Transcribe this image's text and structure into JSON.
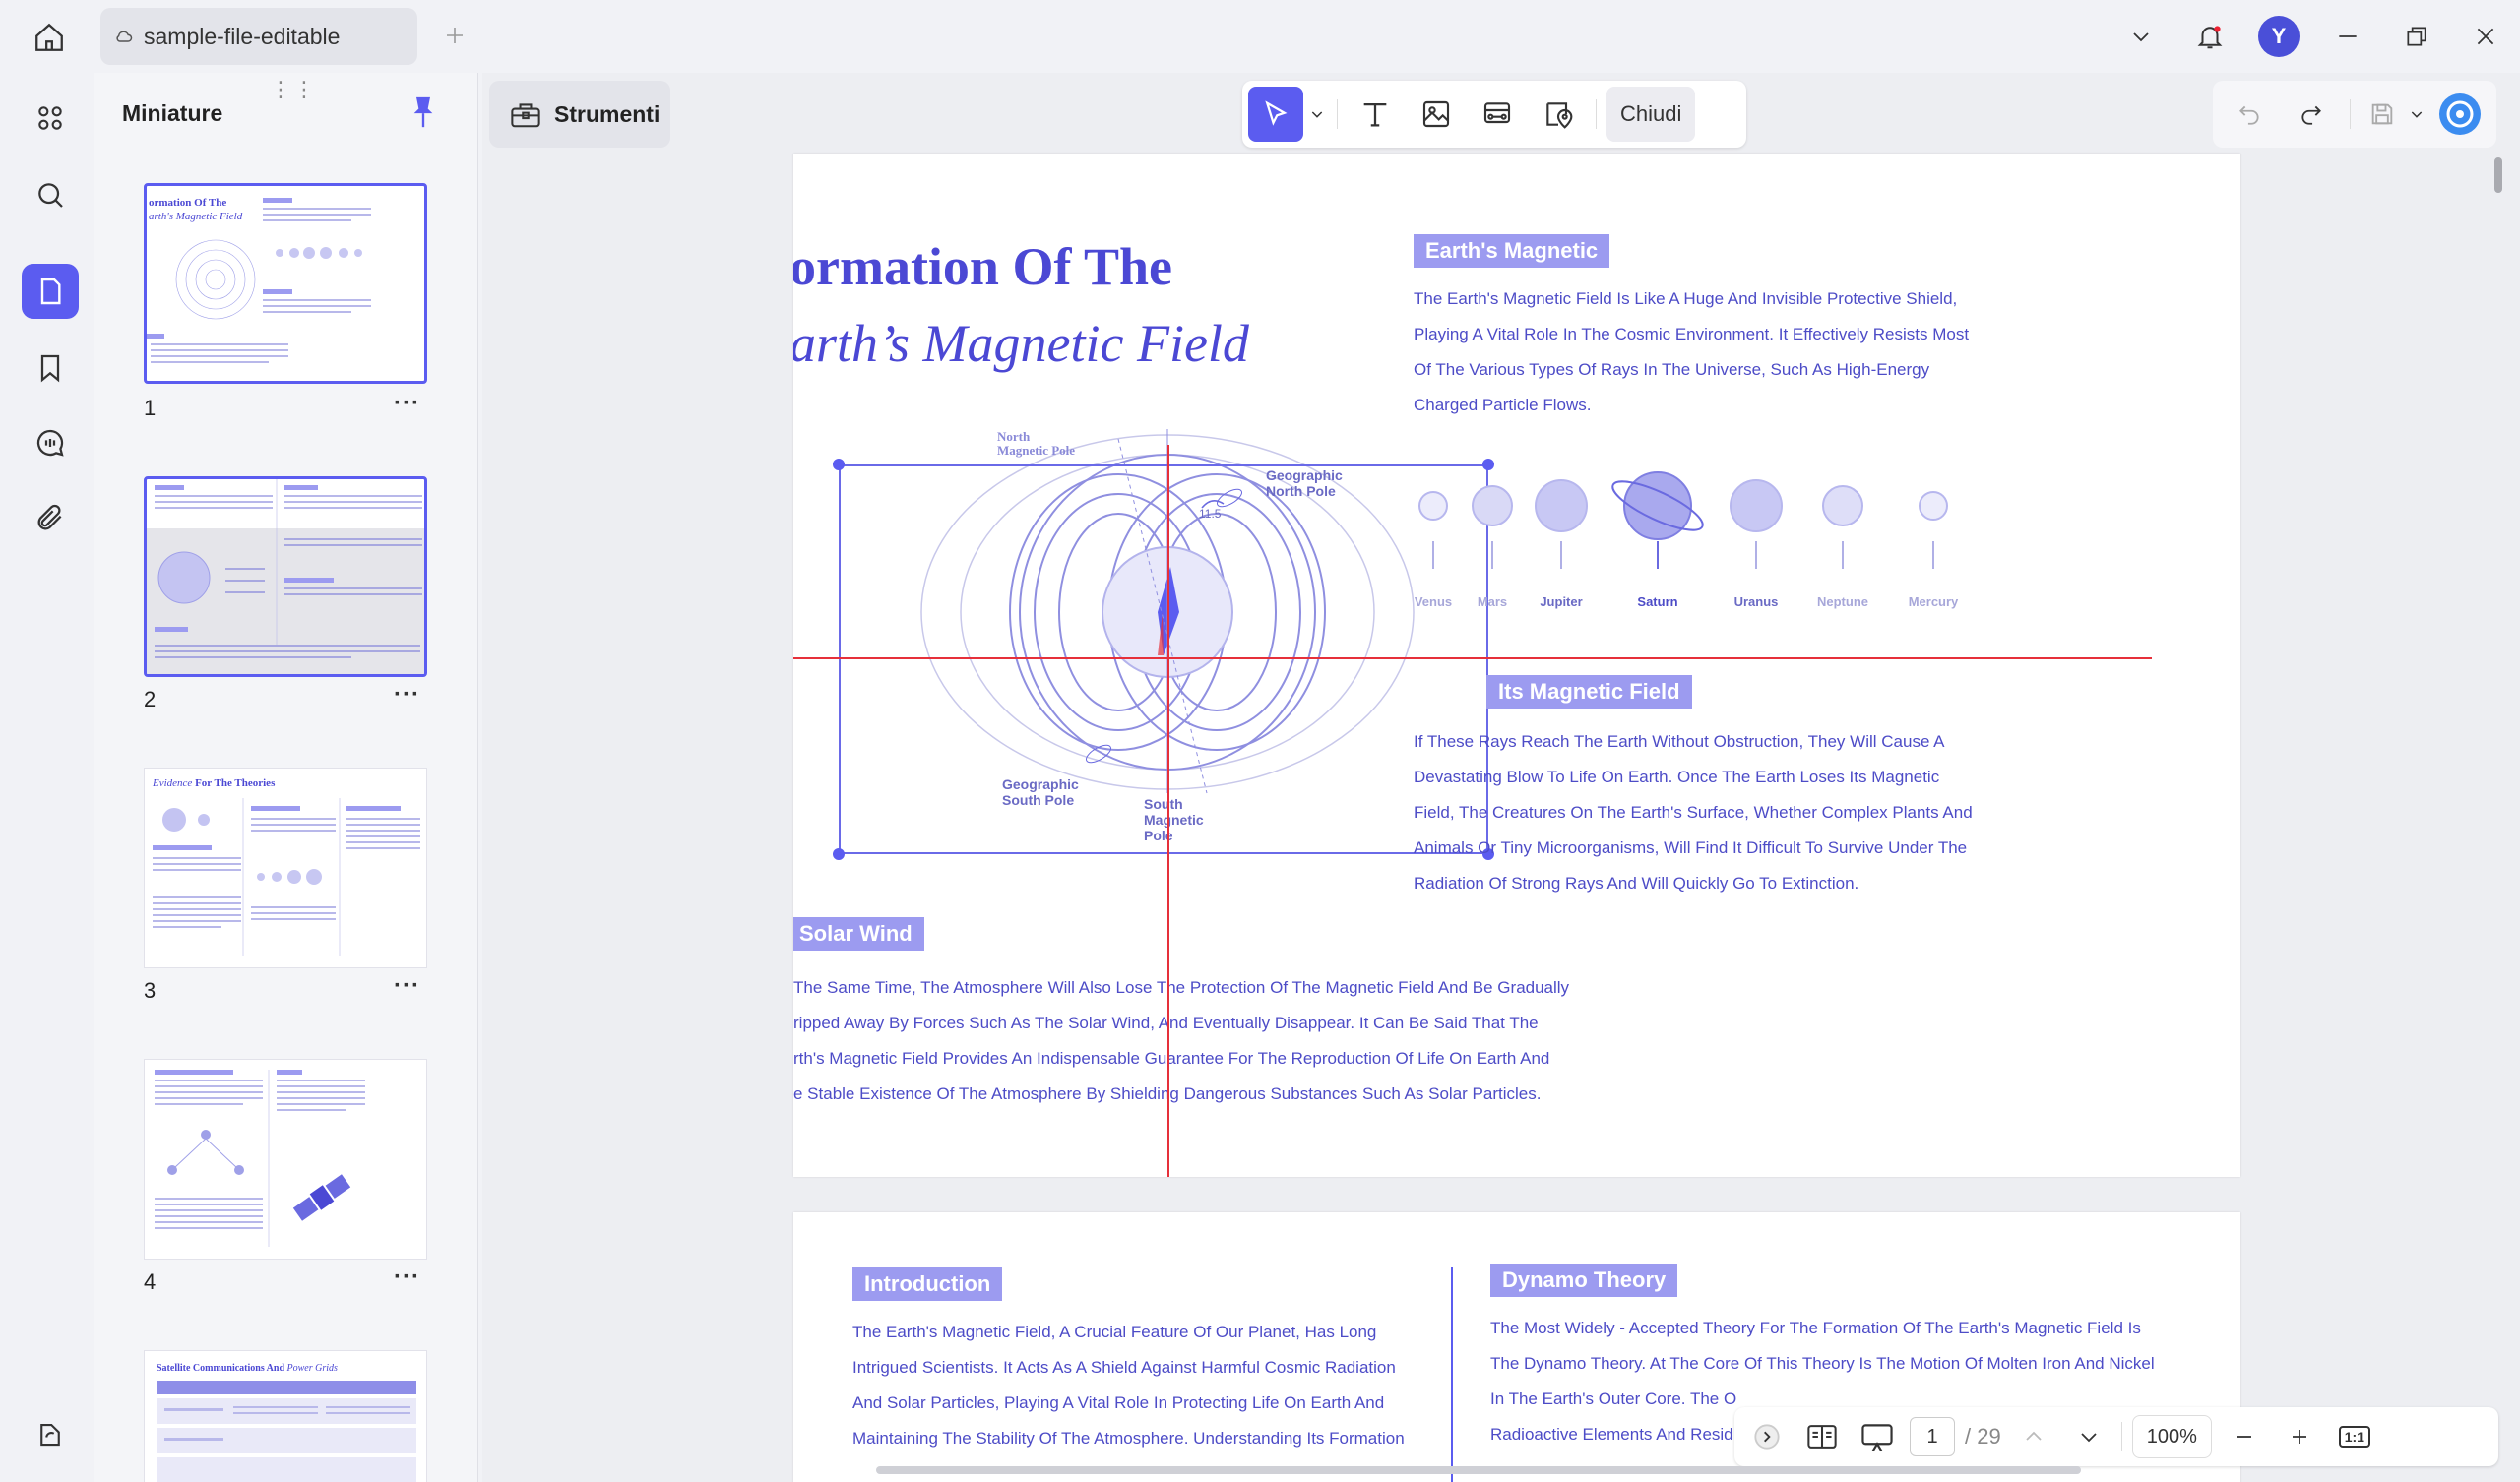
{
  "titlebar": {
    "tab_title": "sample-file-editable",
    "avatar_initial": "Y"
  },
  "thumbnails": {
    "header": "Miniature",
    "pages": [
      {
        "number": "1",
        "more": "···"
      },
      {
        "number": "2",
        "more": "···"
      },
      {
        "number": "3",
        "more": "···"
      },
      {
        "number": "4",
        "more": "···"
      }
    ],
    "page3_title_a": "Evidence",
    "page3_title_b": "For The Theories",
    "page5_title_a": "Satellite Communications And",
    "page5_title_b": "Power Grids"
  },
  "toolbar": {
    "tools_label": "Strumenti",
    "close_label": "Chiudi"
  },
  "page1": {
    "title_line1": "ormation Of The",
    "title_line2": "arth’s Magnetic Field",
    "section1_tag": "Earth's Magnetic",
    "section1_lines": [
      "The Earth's Magnetic Field Is Like A Huge And Invisible Protective Shield,",
      "Playing A Vital Role In The Cosmic Environment. It Effectively Resists Most",
      "Of The Various Types Of Rays In The Universe, Such As High-Energy",
      "Charged Particle Flows."
    ],
    "planets": [
      "Venus",
      "Mars",
      "Jupiter",
      "Saturn",
      "Uranus",
      "Neptune",
      "Mercury"
    ],
    "diagram_labels": {
      "north_magnetic": [
        "North",
        "Magnetic Pole"
      ],
      "geo_north": [
        "Geographic",
        "North Pole"
      ],
      "geo_south": [
        "Geographic",
        "South Pole"
      ],
      "south_magnetic": [
        "South",
        "Magnetic",
        "Pole"
      ],
      "angle": "11.5"
    },
    "section2_tag": "Its Magnetic Field",
    "section2_lines": [
      "If These Rays Reach The Earth Without Obstruction, They Will Cause A",
      "Devastating Blow To Life On Earth. Once The Earth Loses Its Magnetic",
      "Field, The Creatures On The Earth's Surface, Whether Complex Plants And",
      "Animals Or Tiny Microorganisms, Will Find It Difficult To Survive Under The",
      "Radiation Of Strong Rays And Will Quickly Go To Extinction."
    ],
    "section3_tag": "Solar Wind",
    "section3_lines": [
      "The Same Time, The Atmosphere Will Also Lose The Protection Of The Magnetic Field And Be Gradually",
      "ripped Away By Forces Such As The Solar Wind, And Eventually Disappear. It Can Be Said That The",
      "rth's Magnetic Field Provides An Indispensable Guarantee For The Reproduction Of Life On Earth And",
      "e Stable Existence Of The Atmosphere By Shielding Dangerous Substances Such As Solar Particles."
    ]
  },
  "page2": {
    "intro_tag": "Introduction",
    "intro_lines": [
      "The Earth's Magnetic Field, A Crucial Feature Of Our Planet, Has Long",
      "Intrigued Scientists. It Acts As A Shield Against Harmful Cosmic Radiation",
      "And Solar Particles, Playing A Vital Role In Protecting Life On Earth And",
      "Maintaining The Stability Of The Atmosphere. Understanding Its Formation"
    ],
    "dynamo_tag": "Dynamo Theory",
    "dynamo_lines": [
      "The Most Widely - Accepted Theory For The Formation Of The Earth's Magnetic Field Is",
      "The Dynamo Theory. At The Core Of This Theory Is The Motion Of Molten Iron And Nickel",
      "In The Earth's Outer Core. The O",
      "Radioactive Elements And Resid"
    ]
  },
  "bottom": {
    "current_page": "1",
    "total_pages": "/ 29",
    "zoom": "100%",
    "fit_label": "1:1"
  },
  "colors": {
    "accent": "#5b5cf0",
    "heading": "#4b48d4",
    "tag_bg": "#9c9bf0",
    "guide_red": "#e6303a"
  }
}
